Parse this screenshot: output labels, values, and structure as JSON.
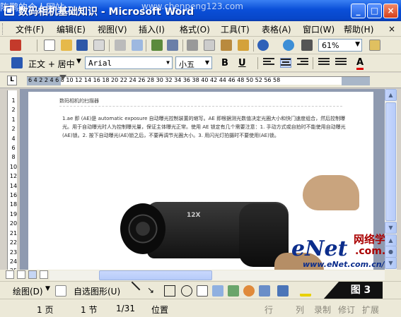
{
  "window": {
    "title": "数码相机基础知识 - Microsoft Word",
    "overlay_text": "陈鹏的个人网站",
    "overlay_url": "www.chenpeng123.com"
  },
  "menubar": {
    "items": [
      "文件(F)",
      "编辑(E)",
      "视图(V)",
      "插入(I)",
      "格式(O)",
      "工具(T)",
      "表格(A)",
      "窗口(W)",
      "帮助(H)"
    ],
    "close_glyph": "×"
  },
  "toolbar_standard": {
    "zoom": "61%"
  },
  "toolbar_format": {
    "style": "正文 + 居中",
    "font": "Arial",
    "size": "小五",
    "bold_label": "B",
    "underline_label": "U",
    "font_color_label": "A"
  },
  "ruler": {
    "tab_selector": "L",
    "ticks": "6  4  2     2   4   6   8  10  12  14  16  18  20  22  24  26  28  30  32  34  36  38  40  42  44  46  48  50  52    56  58",
    "vticks": [
      "1",
      "2",
      "1",
      "2",
      "4",
      "6",
      "8",
      "10",
      "12",
      "14",
      "16",
      "18",
      "19",
      "20",
      "21",
      "22",
      "23",
      "24",
      "25"
    ]
  },
  "document": {
    "header": "数码相机的扫描器",
    "paragraph": "1.ae 即 (AE)是 automatic exposure 自动曝光控制装置的缩写。AE 即根据测光数值决定光圈大小和快门速度组合，然后控制曝光。用于自动曝光时人为控制曝光量，保证主体曝光正常。使用 AE 锁定有几个需要注意：1. 手动方式或自拍时不能使用自动曝光(AE)锁。2. 按下自动曝光(AE)锁之后，不要再调节光圈大小。3. 用闪光灯拍摄时不要使用(AE)锁。",
    "camera_label": "12X",
    "brand": "eNet",
    "brand_cn": "网络学院",
    "brand_domain": ".com.cn",
    "brand_url": "www.eNet.com.cn/eschool"
  },
  "drawing_toolbar": {
    "draw_label": "绘图(D)",
    "autoshapes_label": "自选图形(U)",
    "figure_badge": "图 3"
  },
  "statusbar": {
    "page": "1 页",
    "section": "1 节",
    "page_of": "1/31",
    "position": "位置",
    "line": "行",
    "column": "列",
    "rec": "录制",
    "trk": "修订",
    "ext": "扩展"
  }
}
